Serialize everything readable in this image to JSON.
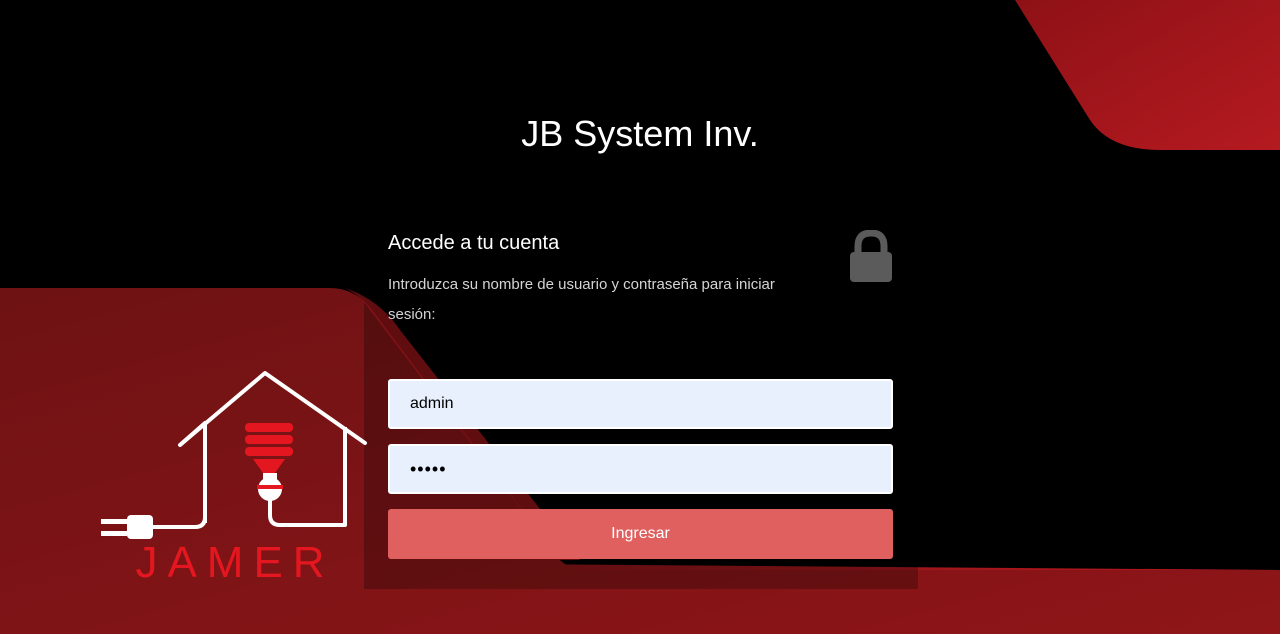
{
  "app": {
    "title_brand": "JB System",
    "title_suffix": "Inv."
  },
  "logo": {
    "wordmark": "JAMER"
  },
  "login": {
    "heading": "Accede a tu cuenta",
    "description": "Introduzca su nombre de usuario y contraseña para iniciar sesión:",
    "username_value": "admin",
    "password_value": "•••••",
    "submit_label": "Ingresar",
    "lock_icon": "lock-icon"
  },
  "colors": {
    "accent_red": "#b3151c",
    "button": "#e06060",
    "input_bg": "#e8f0fe"
  }
}
